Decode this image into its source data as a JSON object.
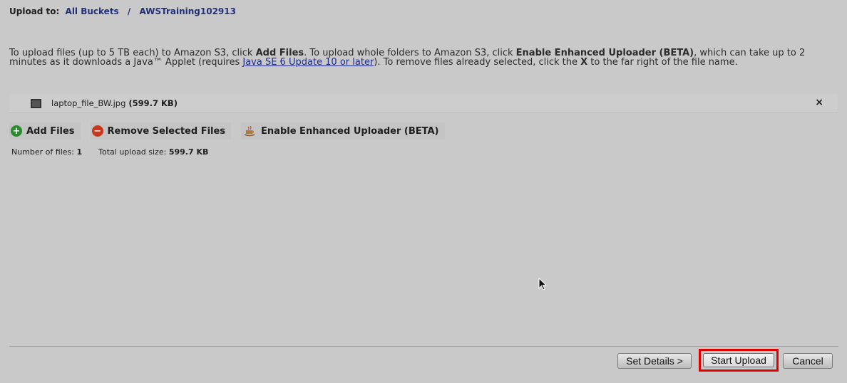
{
  "header": {
    "prefix": "Upload to:",
    "crumbs": [
      "All Buckets",
      "AWSTraining102913"
    ],
    "separator": "/"
  },
  "intro": {
    "t1": "To upload files (up to 5 TB each) to Amazon S3, click ",
    "b1": "Add Files",
    "t2": ". To upload whole folders to Amazon S3, click ",
    "b2": "Enable Enhanced Uploader (BETA)",
    "t3": ", which can take up to 2 minutes as it downloads a Java™ Applet (requires ",
    "link": "Java SE 6 Update 10 or later",
    "t4": "). To remove files already selected, click the ",
    "b3": "X",
    "t5": " to the far right of the file name."
  },
  "file": {
    "name": "laptop_file_BW.jpg",
    "size": "(599.7 KB)",
    "remove_icon": "×"
  },
  "toolbar": {
    "add_label": "Add Files",
    "remove_label": "Remove Selected Files",
    "enhanced_label": "Enable Enhanced Uploader (BETA)"
  },
  "summary": {
    "files_label": "Number of files:",
    "files_value": "1",
    "size_label": "Total upload size:",
    "size_value": "599.7 KB"
  },
  "footer": {
    "details_label": "Set Details >",
    "start_label": "Start Upload",
    "cancel_label": "Cancel"
  },
  "colors": {
    "background": "#c9c9c9",
    "link": "#23317a",
    "highlight": "#e00000"
  }
}
